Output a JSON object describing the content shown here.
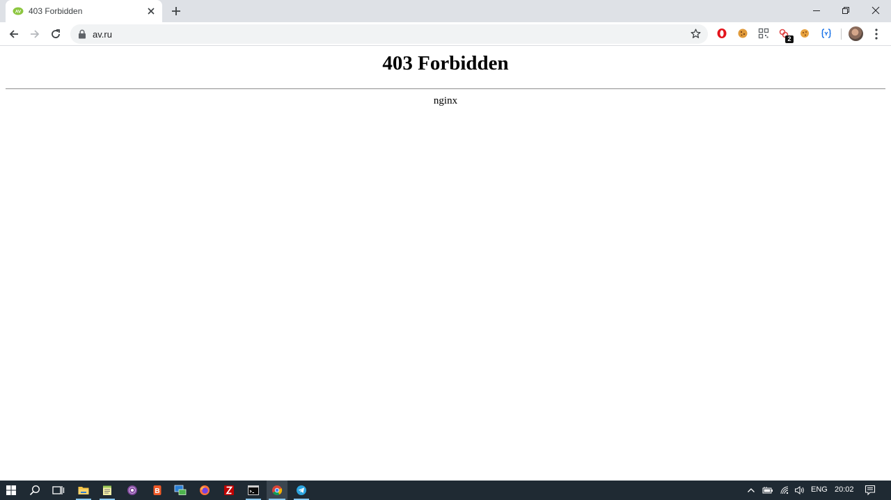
{
  "browser": {
    "tab": {
      "title": "403 Forbidden",
      "favicon": "av-ru-favicon"
    },
    "address_bar": {
      "url": "av.ru"
    },
    "extensions": [
      {
        "name": "opera-vpn-extension-icon",
        "color": "#e3141c"
      },
      {
        "name": "cookie-extension-icon",
        "color": "#d48a2c"
      },
      {
        "name": "qr-code-extension-icon",
        "color": "#5f6368"
      },
      {
        "name": "link-extension-icon",
        "color": "#e04646",
        "badge": "2"
      },
      {
        "name": "cookie-editor-extension-icon",
        "color": "#d48a2c"
      },
      {
        "name": "json-extension-icon",
        "color": "#1a73e8"
      }
    ]
  },
  "page": {
    "heading": "403 Forbidden",
    "server": "nginx"
  },
  "taskbar": {
    "apps": [
      "start-icon",
      "search-icon",
      "task-view-icon",
      "file-explorer-icon",
      "notepad-icon",
      "tor-browser-icon",
      "browser-app-icon",
      "remote-desktop-icon",
      "firefox-icon",
      "filezilla-icon",
      "terminal-icon",
      "chrome-icon",
      "telegram-icon"
    ],
    "tray": {
      "language": "ENG",
      "time": "20:02"
    }
  },
  "colors": {
    "tabstrip": "#dee1e6",
    "taskbar": "#1f2a33",
    "accent": "#1a73e8"
  }
}
